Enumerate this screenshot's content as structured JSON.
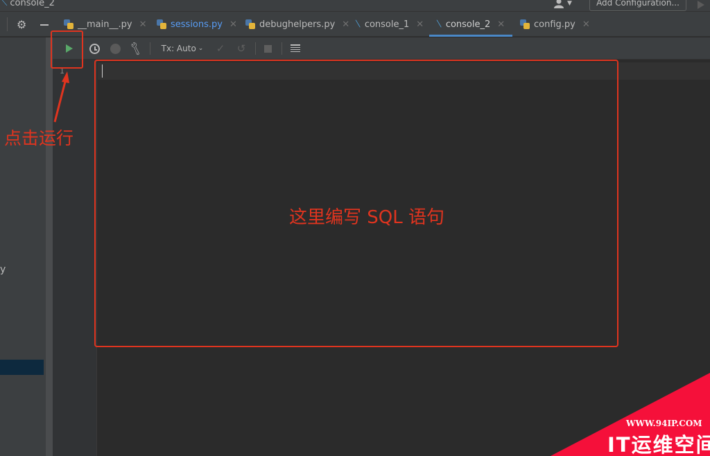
{
  "window": {
    "title": "console_2",
    "add_configuration_label": "Add Configuration..."
  },
  "tabs": [
    {
      "label": "__main__.py",
      "icon": "python-file-icon",
      "active": false
    },
    {
      "label": "sessions.py",
      "icon": "python-file-icon",
      "active": false
    },
    {
      "label": "debughelpers.py",
      "icon": "python-file-icon",
      "active": false
    },
    {
      "label": "console_1",
      "icon": "sql-console-icon",
      "active": false
    },
    {
      "label": "console_2",
      "icon": "sql-console-icon",
      "active": true
    },
    {
      "label": "config.py",
      "icon": "python-file-icon",
      "active": false
    }
  ],
  "toolbar": {
    "tx_mode": "Tx: Auto",
    "icons": [
      "run-icon",
      "history-icon",
      "stop-circle-icon",
      "wrench-icon",
      "check-icon",
      "undo-icon",
      "stop-icon",
      "table-icon"
    ]
  },
  "editor": {
    "line_number": "1",
    "content": ""
  },
  "left_panel": {
    "fragment": "y"
  },
  "annotations": {
    "run_hint": "点击运行",
    "editor_hint": "这里编写 SQL 语句",
    "color": "#e0341f"
  },
  "watermark": {
    "url": "WWW.94IP.COM",
    "brand": "IT运维空间",
    "color": "#f5103a"
  },
  "colors": {
    "accent_tab": "#4a88c7",
    "run_green": "#59a869",
    "background": "#2b2b2b"
  }
}
